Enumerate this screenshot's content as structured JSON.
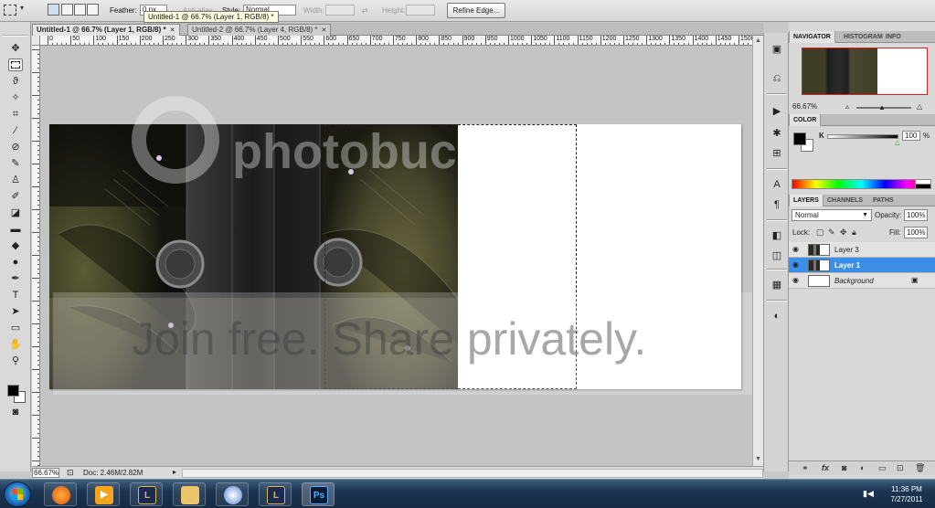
{
  "options_bar": {
    "feather_label": "Feather:",
    "feather_value": "0 px",
    "antialias_label": "Anti-alias",
    "style_label": "Style:",
    "style_value": "Normal",
    "width_label": "Width:",
    "height_label": "Height:",
    "refine_edge_label": "Refine Edge..."
  },
  "tooltip": "Untitled-1 @ 66.7% (Layer 1, RGB/8) *",
  "doc_tabs": [
    {
      "label": "Untitled-1 @ 66.7% (Layer 1, RGB/8) *",
      "close": "✕",
      "active": true
    },
    {
      "label": "Untitled-2 @ 66.7% (Layer 4, RGB/8) *",
      "close": "✕",
      "active": false
    }
  ],
  "ruler_labels": [
    "0",
    "50",
    "100",
    "150",
    "200",
    "250",
    "300",
    "350",
    "400",
    "450",
    "500",
    "550",
    "600",
    "650",
    "700",
    "750",
    "800",
    "850",
    "900",
    "950",
    "1000",
    "1050",
    "1100",
    "1150",
    "1200",
    "1250",
    "1300",
    "1350",
    "1400",
    "1450",
    "1500"
  ],
  "status_bar": {
    "zoom": "66.67%",
    "doc_size": "Doc: 2.46M/2.82M",
    "arrow": "▸"
  },
  "watermark": {
    "brand": "photobucket",
    "slogan": "Join free. Share privately."
  },
  "panels": {
    "navigator_tabs": [
      "NAVIGATOR",
      "HISTOGRAM",
      "INFO"
    ],
    "navigator_zoom": "66.67%",
    "color_tab": "COLOR",
    "color_channel": "K",
    "color_value": "100",
    "color_unit": "%",
    "layers_tabs": [
      "LAYERS",
      "CHANNELS",
      "PATHS"
    ],
    "blend_mode": "Normal",
    "opacity_label": "Opacity:",
    "opacity_value": "100%",
    "lock_label": "Lock:",
    "fill_label": "Fill:",
    "fill_value": "100%",
    "layers": [
      {
        "name": "Layer 3",
        "selected": false
      },
      {
        "name": "Layer 1",
        "selected": true
      },
      {
        "name": "Background",
        "selected": false
      }
    ]
  },
  "taskbar": {
    "time": "11:36 PM",
    "date": "7/27/2011",
    "apps": [
      "firefox",
      "media-player",
      "league-of-legends",
      "file-explorer",
      "game-client",
      "league-of-legends",
      "photoshop"
    ],
    "ps_label": "Ps",
    "lol_label": "L"
  },
  "colors": {
    "accent_selected_layer": "#3d8ee6",
    "navigator_view_box": "#e02020"
  }
}
